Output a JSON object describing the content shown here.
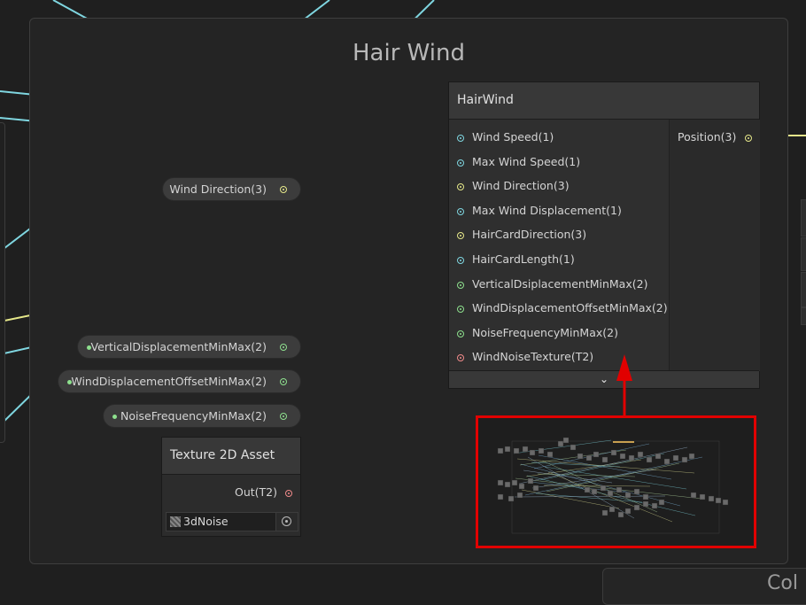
{
  "group": {
    "title": "Hair Wind"
  },
  "node": {
    "title": "HairWind",
    "inputs": [
      {
        "label": "Wind Speed(1)",
        "color": "#7fd6e0"
      },
      {
        "label": "Max Wind Speed(1)",
        "color": "#7fd6e0"
      },
      {
        "label": "Wind Direction(3)",
        "color": "#e6e88a"
      },
      {
        "label": "Max Wind Displacement(1)",
        "color": "#7fd6e0"
      },
      {
        "label": "HairCardDirection(3)",
        "color": "#e6e88a"
      },
      {
        "label": "HairCardLength(1)",
        "color": "#7fd6e0"
      },
      {
        "label": "VerticalDsiplacementMinMax(2)",
        "color": "#8ee08e"
      },
      {
        "label": "WindDisplacementOffsetMinMax(2)",
        "color": "#8ee08e"
      },
      {
        "label": "NoiseFrequencyMinMax(2)",
        "color": "#8ee08e"
      },
      {
        "label": "WindNoiseTexture(T2)",
        "color": "#f08a8a"
      }
    ],
    "outputs": [
      {
        "label": "Position(3)",
        "color": "#e6e88a"
      }
    ],
    "collapse_glyph": "⌄"
  },
  "properties": [
    {
      "label": "Wind Direction(3)",
      "color": "#e6e88a"
    },
    {
      "label": "VerticalDisplacementMinMax(2)",
      "color": "#8ee08e"
    },
    {
      "label": "WindDisplacementOffsetMinMax(2)",
      "color": "#8ee08e"
    },
    {
      "label": "NoiseFrequencyMinMax(2)",
      "color": "#8ee08e"
    }
  ],
  "texture_node": {
    "title": "Texture 2D Asset",
    "output_label": "Out(T2)",
    "output_color": "#f08a8a",
    "field_value": "3dNoise"
  },
  "bottom_group": {
    "title_fragment": "Col"
  },
  "colors": {
    "float": "#7fd6e0",
    "vector3": "#e6e88a",
    "vector2": "#8ee08e",
    "texture": "#f08a8a",
    "annotation": "#e10000"
  }
}
